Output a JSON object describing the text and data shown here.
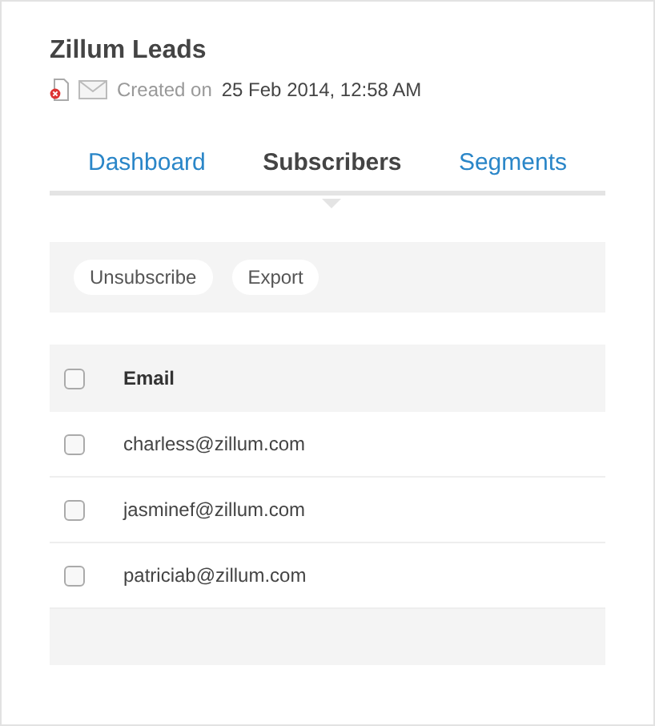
{
  "title": "Zillum Leads",
  "meta": {
    "label": "Created on",
    "date": "25 Feb 2014, 12:58 AM"
  },
  "tabs": [
    {
      "label": "Dashboard",
      "selected": false
    },
    {
      "label": "Subscribers",
      "selected": true
    },
    {
      "label": "Segments",
      "selected": false
    }
  ],
  "actions": [
    "Unsubscribe",
    "Export"
  ],
  "table": {
    "columns": [
      "Email"
    ],
    "header_checked": false,
    "rows": [
      {
        "email": "charless@zillum.com",
        "checked": false
      },
      {
        "email": "jasminef@zillum.com",
        "checked": false
      },
      {
        "email": "patriciab@zillum.com",
        "checked": false
      }
    ]
  }
}
